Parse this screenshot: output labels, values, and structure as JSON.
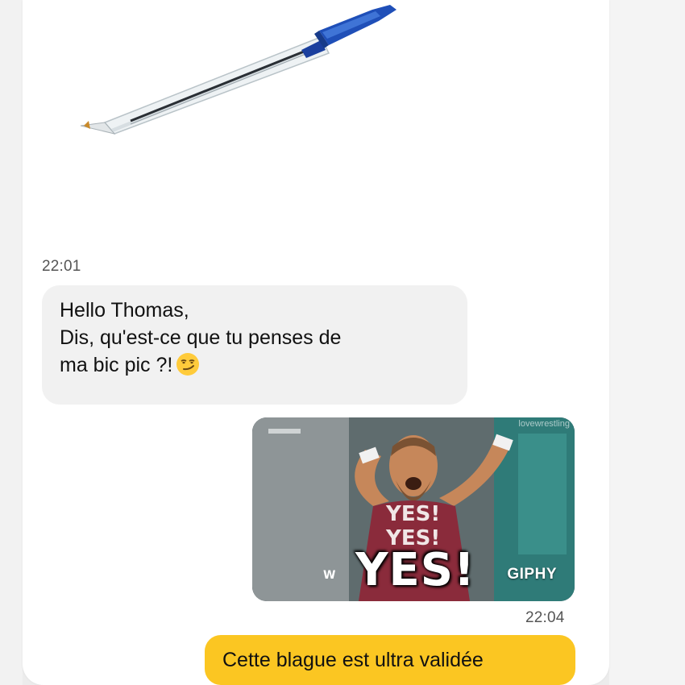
{
  "messages": {
    "image_timestamp": "22:01",
    "incoming": {
      "line1": "Hello Thomas,",
      "line2": "Dis, qu'est-ce que tu penses de",
      "line3": "ma bic pic ?!",
      "emoji": "smirking-face"
    },
    "gif": {
      "caption": "YES!",
      "provider": "GIPHY",
      "watermark": "lovewrestling",
      "timestamp": "22:04"
    },
    "outgoing": {
      "text": "Cette blague est ultra validée"
    }
  },
  "colors": {
    "incoming_bubble": "#f1f1f1",
    "outgoing_bubble": "#fbc622",
    "timestamp_text": "#555555"
  },
  "icons": [
    "bic-pen-image",
    "smirking-face-emoji",
    "giphy-gif"
  ]
}
